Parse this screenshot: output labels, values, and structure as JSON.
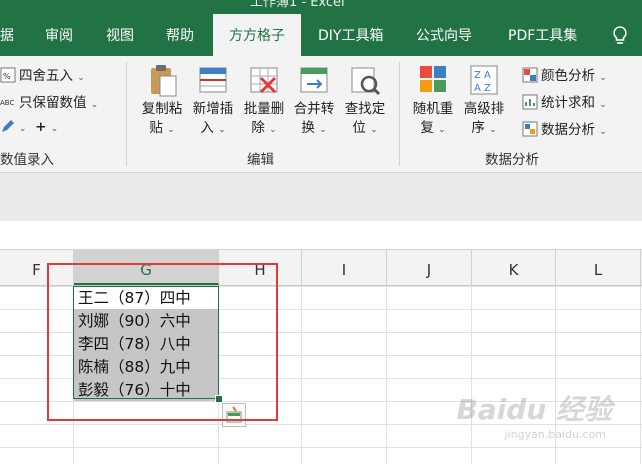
{
  "window": {
    "title": "工作簿1 - Excel"
  },
  "tabs": [
    {
      "label": "据"
    },
    {
      "label": "审阅"
    },
    {
      "label": "视图"
    },
    {
      "label": "帮助"
    },
    {
      "label": "方方格子",
      "active": true
    },
    {
      "label": "DIY工具箱"
    },
    {
      "label": "公式向导"
    },
    {
      "label": "PDF工具集"
    }
  ],
  "ribbon": {
    "group1": {
      "items": [
        "四舍五入",
        "只保留数值"
      ],
      "label": "数值录入",
      "plus": "+"
    },
    "edit": {
      "buttons": [
        {
          "line1": "复制粘",
          "line2": "贴"
        },
        {
          "line1": "新增插",
          "line2": "入"
        },
        {
          "line1": "批量删",
          "line2": "除"
        },
        {
          "line1": "合并转",
          "line2": "换"
        },
        {
          "line1": "查找定",
          "line2": "位"
        }
      ],
      "label": "编辑"
    },
    "analysis": {
      "buttons": [
        {
          "line1": "随机重",
          "line2": "复"
        },
        {
          "line1": "高级排",
          "line2": "序"
        }
      ],
      "small": [
        "颜色分析",
        "统计求和",
        "数据分析"
      ],
      "label": "数据分析"
    }
  },
  "columns": [
    "F",
    "G",
    "H",
    "I",
    "J",
    "K",
    "L"
  ],
  "cells": [
    "王二（87）四中",
    "刘娜（90）六中",
    "李四（78）八中",
    "陈楠（88）九中",
    "彭毅（76）十中"
  ],
  "watermark": {
    "brand": "Baidu 经验",
    "url": "jingyan.baidu.com"
  },
  "colors": {
    "excel_green": "#217346",
    "highlight_red": "#e03a3a"
  }
}
